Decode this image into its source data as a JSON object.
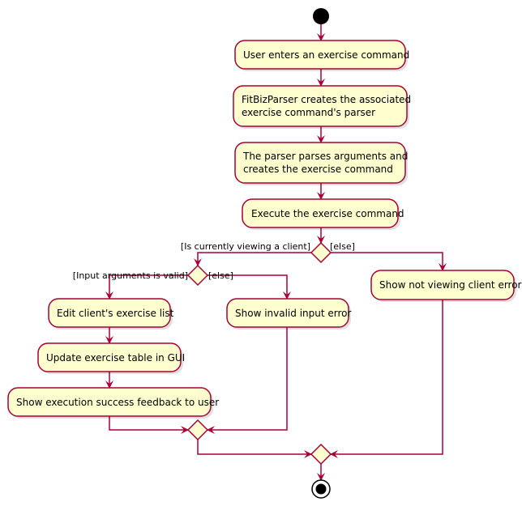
{
  "colors": {
    "fill": "#FEFECE",
    "border": "#A80036"
  },
  "activities": [
    {
      "lines": [
        "User enters an exercise command"
      ]
    },
    {
      "lines": [
        "FitBizParser creates the associated",
        "exercise command's parser"
      ]
    },
    {
      "lines": [
        "The parser parses arguments and",
        "creates the exercise command"
      ]
    },
    {
      "lines": [
        "Execute the exercise command"
      ]
    },
    {
      "lines": [
        "Show not viewing client error"
      ]
    },
    {
      "lines": [
        "Edit client's exercise list"
      ]
    },
    {
      "lines": [
        "Show invalid input error"
      ]
    },
    {
      "lines": [
        "Update exercise table in GUI"
      ]
    },
    {
      "lines": [
        "Show execution success feedback to user"
      ]
    }
  ],
  "guards": {
    "viewing_client": "[Is currently viewing a client]",
    "else1": "[else]",
    "input_valid": "[Input arguments is valid]",
    "else2": "[else]"
  }
}
